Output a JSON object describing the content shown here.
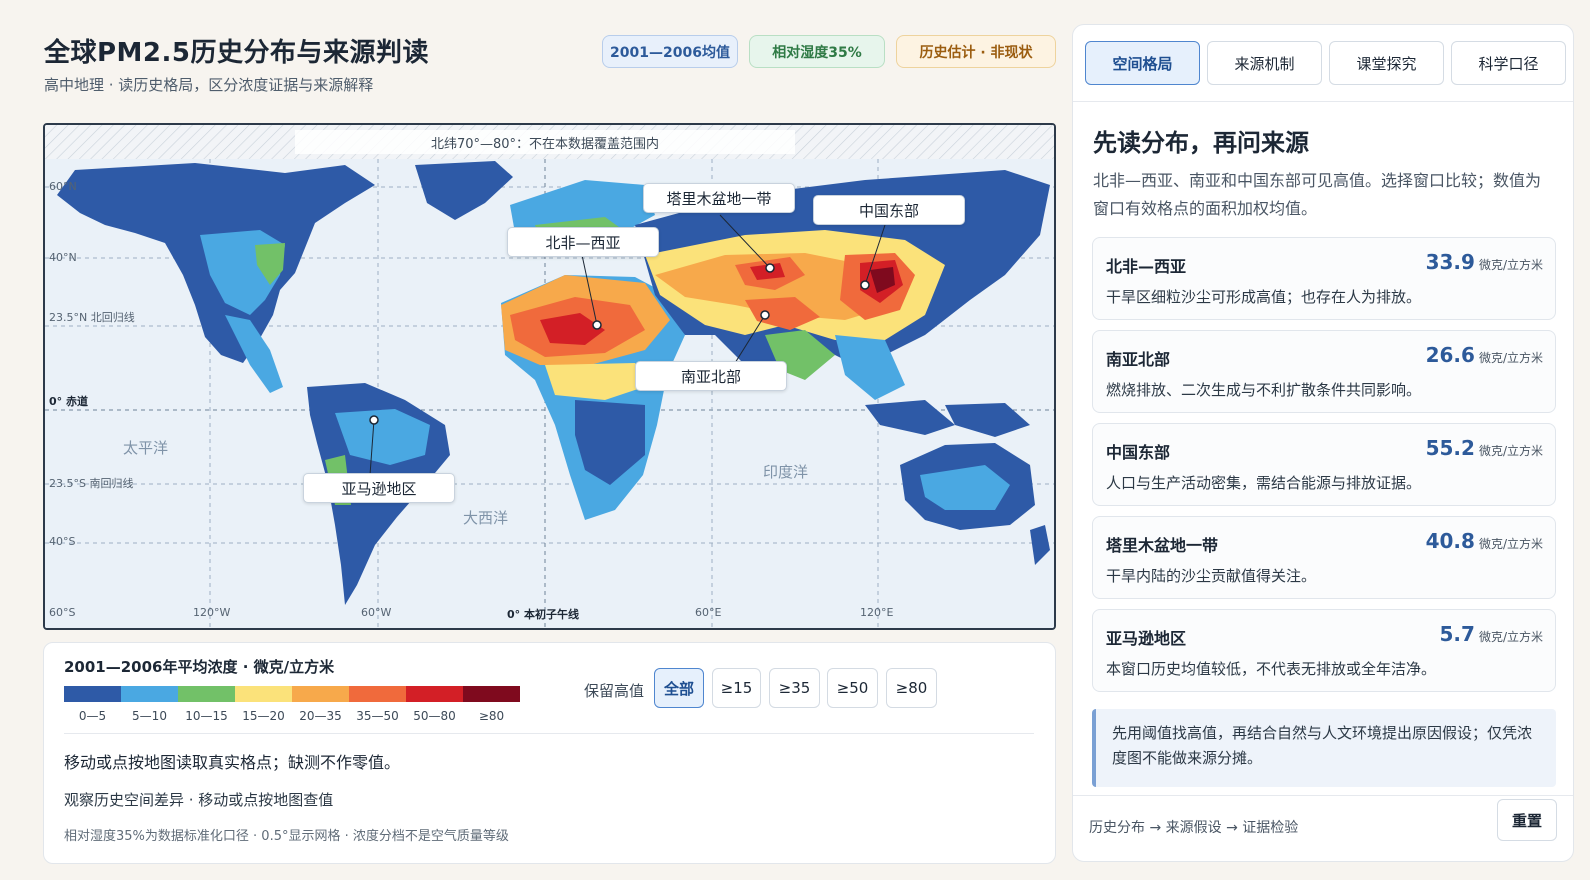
{
  "header": {
    "title": "全球PM2.5历史分布与来源判读",
    "subtitle": "高中地理 · 读历史格局，区分浓度证据与来源解释",
    "tags": [
      "2001—2006均值",
      "相对湿度35%",
      "历史估计 · 非现状"
    ]
  },
  "map": {
    "no_data_band": "北纬70°—80°：不在本数据覆盖范围内",
    "lat_labels": [
      "60°N",
      "40°N",
      "23.5°N 北回归线",
      "0° 赤道",
      "23.5°S 南回归线",
      "40°S",
      "60°S"
    ],
    "lon_labels": [
      "120°W",
      "60°W",
      "0° 本初子午线",
      "60°E",
      "120°E"
    ],
    "oceans": [
      "太平洋",
      "大西洋",
      "印度洋"
    ],
    "callouts": [
      "北非—西亚",
      "塔里木盆地一带",
      "中国东部",
      "南亚北部",
      "亚马逊地区"
    ]
  },
  "legend": {
    "title": "2001—2006年平均浓度 · 微克/立方米",
    "bins": [
      "0—5",
      "5—10",
      "10—15",
      "15—20",
      "20—35",
      "35—50",
      "50—80",
      "≥80"
    ],
    "bin_colors": [
      "#2e5aa7",
      "#4aa8e2",
      "#72c168",
      "#fbe27a",
      "#f7a94b",
      "#f06a3c",
      "#d31f26",
      "#7f0a1e"
    ],
    "keep_label": "保留高值",
    "thresholds": [
      "全部",
      "≥15",
      "≥35",
      "≥50",
      "≥80"
    ],
    "active_threshold": "全部",
    "hint": "移动或点按地图读取真实格点；缺测不作零值。",
    "status": "观察历史空间差异 · 移动或点按地图查值",
    "note": "相对湿度35%为数据标准化口径 · 0.5°显示网格 · 浓度分档不是空气质量等级"
  },
  "panel": {
    "tabs": [
      "空间格局",
      "来源机制",
      "课堂探究",
      "科学口径"
    ],
    "active_tab": "空间格局",
    "heading": "先读分布，再问来源",
    "description": "北非—西亚、南亚和中国东部可见高值。选择窗口比较；数值为窗口有效格点的面积加权均值。",
    "unit": "微克/立方米",
    "regions": [
      {
        "name": "北非—西亚",
        "value": "33.9",
        "desc": "干旱区细粒沙尘可形成高值；也存在人为排放。"
      },
      {
        "name": "南亚北部",
        "value": "26.6",
        "desc": "燃烧排放、二次生成与不利扩散条件共同影响。"
      },
      {
        "name": "中国东部",
        "value": "55.2",
        "desc": "人口与生产活动密集，需结合能源与排放证据。"
      },
      {
        "name": "塔里木盆地一带",
        "value": "40.8",
        "desc": "干旱内陆的沙尘贡献值得关注。"
      },
      {
        "name": "亚马逊地区",
        "value": "5.7",
        "desc": "本窗口历史均值较低，不代表无排放或全年洁净。"
      }
    ],
    "tip": "先用阈值找高值，再结合自然与人文环境提出原因假设；仅凭浓度图不能做来源分摊。",
    "footer": "历史分布 → 来源假设 → 证据检验",
    "reset": "重置"
  }
}
